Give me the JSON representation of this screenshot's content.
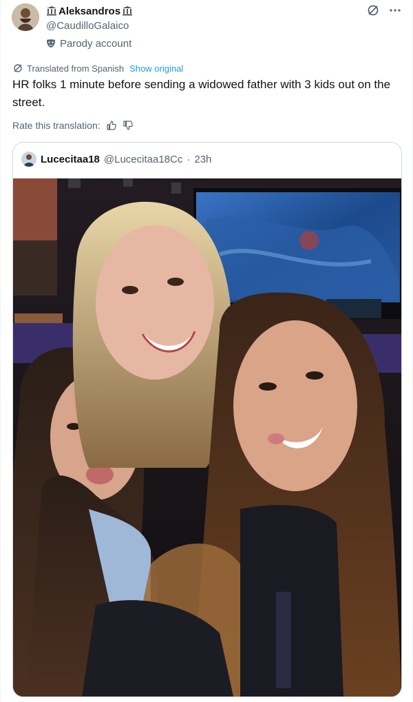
{
  "author": {
    "display_name": "Aleksandros",
    "handle": "@CaudilloGalaico",
    "parody_label": "Parody account",
    "name_badge_icon": "classical-building-icon"
  },
  "actions": {
    "grok_icon": "grok-icon",
    "more_icon": "more-icon"
  },
  "translation": {
    "label": "Translated from Spanish",
    "show_original": "Show original"
  },
  "tweet": {
    "text": "HR folks 1 minute before sending a widowed father with 3 kids out on the street."
  },
  "rating": {
    "label": "Rate this translation:"
  },
  "quoted": {
    "display_name": "Lucecitaa18",
    "handle": "@Lucecitaa18Cc",
    "separator": "·",
    "time": "23h",
    "media_alt": "Selfie of three young women smiling in front of a large screen showing a game at an esports event"
  },
  "colors": {
    "text": "#0f1419",
    "secondary": "#536471",
    "link": "#1d9bf0",
    "border": "#cfd9de"
  }
}
